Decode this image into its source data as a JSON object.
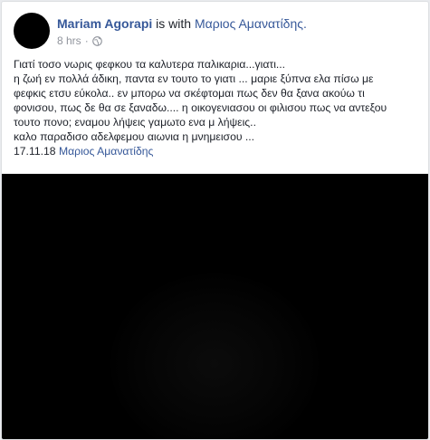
{
  "post": {
    "author": "Mariam Agorapi",
    "with_text": "is with",
    "tagged": "Μαριος Αμανατίδης.",
    "timestamp": "8 hrs",
    "separator": "·",
    "privacy_icon": "globe-icon",
    "lines": [
      "Γιατί τοσο νωρις φεφκου τα καλυτερα παλικαρια...γιατι...",
      "η ζωή εν πολλά άδικη, παντα εν τουτο το γιατι ... μαριε ξύπνα ελα πίσω με",
      "φεφκις ετσυ εύκολα.. εν μπορω να σκέφτομαι πως δεν θα ξανα ακούω τι",
      "φονισου, πως δε θα σε ξαναδω.... η οικογενιασου οι φιλισου πως να αντεξου",
      "τουτο πονο; εναμου λήψεις γαμωτο ενα μ λήψεις..",
      "καλο παραδισο αδελφεμου αιωνια η μνημεισου ..."
    ],
    "date_line": "17.11.18",
    "signature": "Μαριος Αμανατίδης"
  },
  "colors": {
    "link": "#365899",
    "text": "#1d2129",
    "meta": "#90949c",
    "background": "#e9ebee"
  }
}
